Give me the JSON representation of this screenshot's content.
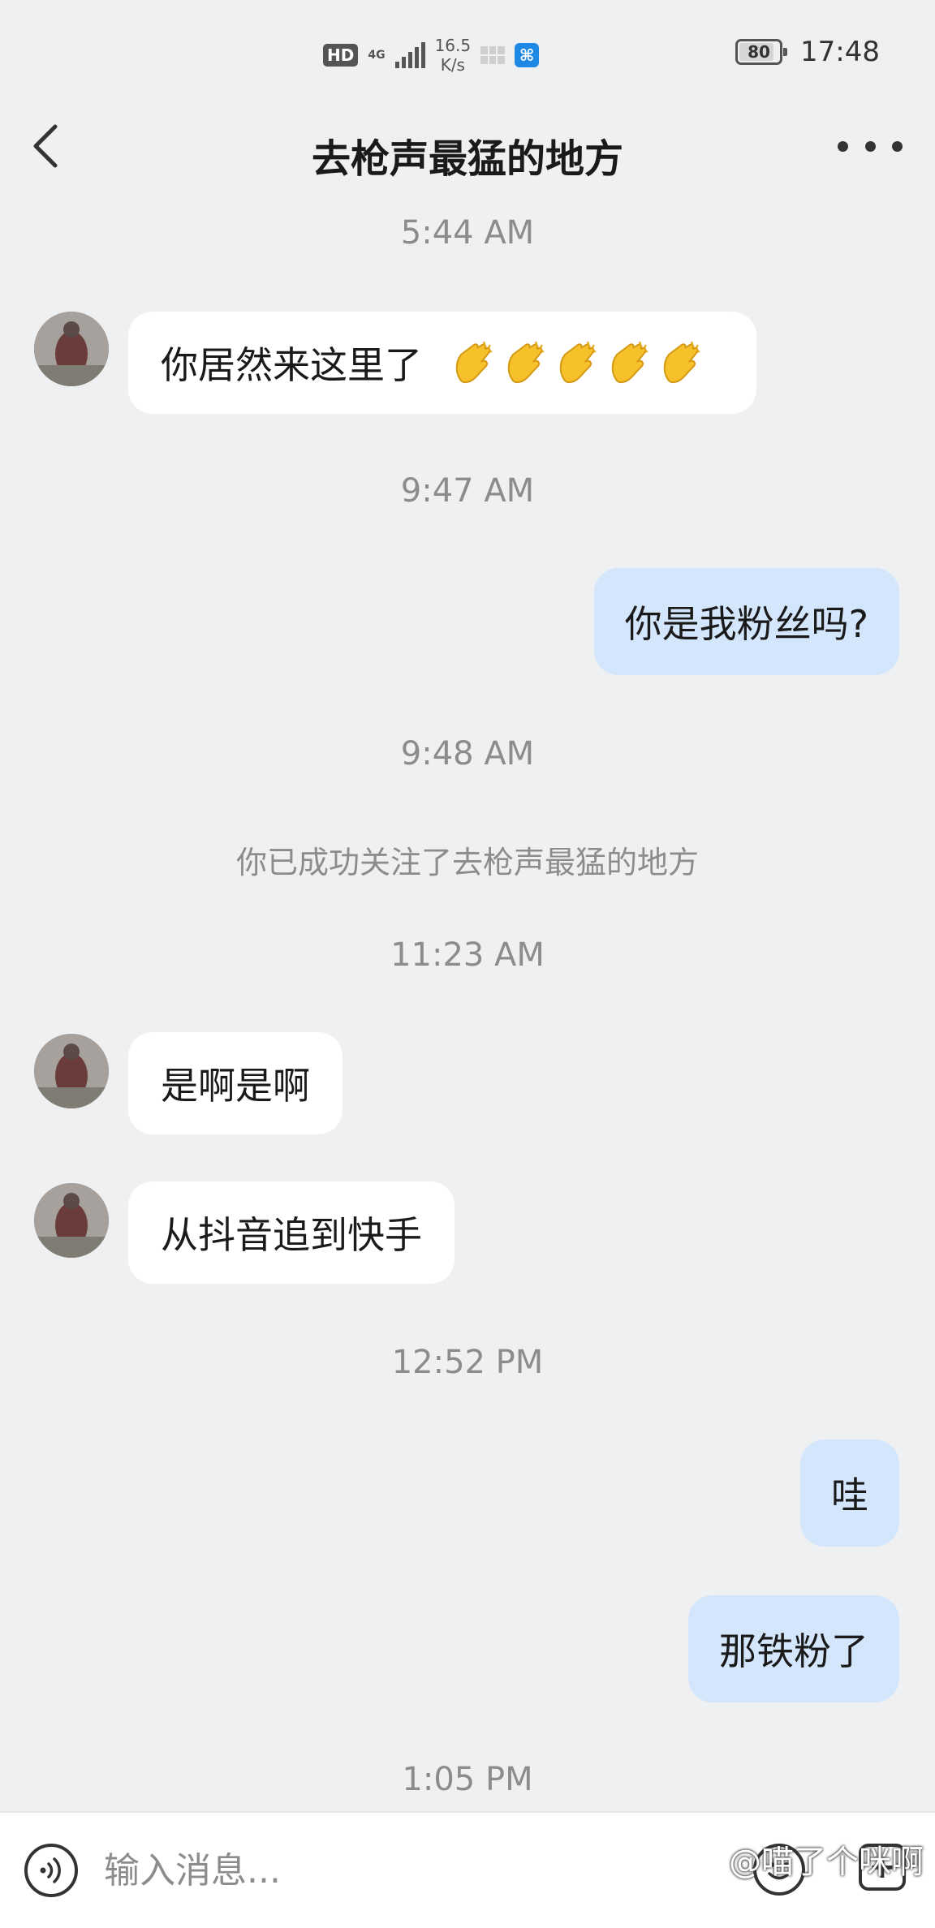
{
  "status_bar": {
    "hd": "HD",
    "network": "4G",
    "speed_value": "16.5",
    "speed_unit": "K/s",
    "battery": "80",
    "battery_level": 0.8,
    "time": "17:48"
  },
  "header": {
    "title": "去枪声最猛的地方"
  },
  "messages": [
    {
      "type": "timestamp",
      "text": "5:44 AM"
    },
    {
      "type": "incoming",
      "text": "你居然来这里了",
      "emoji": [
        "clapping-hands",
        "clapping-hands",
        "clapping-hands",
        "clapping-hands",
        "clapping-hands"
      ]
    },
    {
      "type": "timestamp",
      "text": "9:47 AM"
    },
    {
      "type": "outgoing",
      "text": "你是我粉丝吗?"
    },
    {
      "type": "timestamp",
      "text": "9:48 AM"
    },
    {
      "type": "notice",
      "text": "你已成功关注了去枪声最猛的地方"
    },
    {
      "type": "timestamp",
      "text": "11:23 AM"
    },
    {
      "type": "incoming",
      "text": "是啊是啊"
    },
    {
      "type": "incoming",
      "text": "从抖音追到快手"
    },
    {
      "type": "timestamp",
      "text": "12:52 PM"
    },
    {
      "type": "outgoing",
      "text": "哇"
    },
    {
      "type": "outgoing",
      "text": "那铁粉了"
    },
    {
      "type": "timestamp",
      "text": "1:05 PM"
    }
  ],
  "input_bar": {
    "placeholder": "输入消息...",
    "icons": [
      "voice-icon",
      "emoji-icon",
      "plus-icon"
    ]
  },
  "watermark": "@喵了个咪啊",
  "colors": {
    "background": "#eff0f2",
    "incoming_bubble": "#ffffff",
    "outgoing_bubble": "#d3e6fc",
    "timestamp_text": "#8c8c8c",
    "app_icon": "#1e88e5"
  }
}
